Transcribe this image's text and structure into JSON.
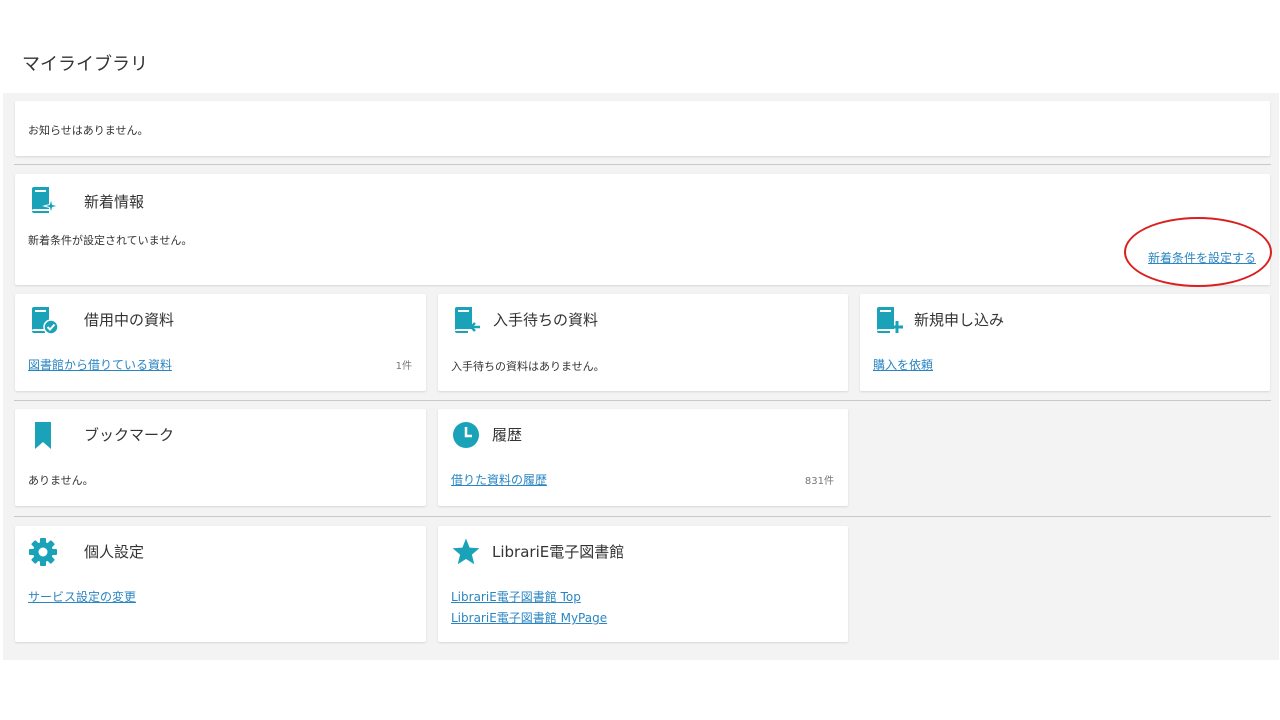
{
  "page_title": "マイライブラリ",
  "notice": {
    "text": "お知らせはありません。"
  },
  "new_info": {
    "title": "新着情報",
    "status": "新着条件が設定されていません。",
    "link": "新着条件を設定する"
  },
  "borrowing": {
    "title": "借用中の資料",
    "link": "図書館から借りている資料",
    "count": "1件"
  },
  "waiting": {
    "title": "入手待ちの資料",
    "status": "入手待ちの資料はありません。"
  },
  "new_request": {
    "title": "新規申し込み",
    "link": "購入を依頼"
  },
  "bookmark": {
    "title": "ブックマーク",
    "status": "ありません。"
  },
  "history": {
    "title": "履歴",
    "link": "借りた資料の履歴",
    "count": "831件"
  },
  "settings": {
    "title": "個人設定",
    "link": "サービス設定の変更"
  },
  "librarie": {
    "title": "LibrariE電子図書館",
    "link_top": "LibrariE電子図書館 Top",
    "link_mypage": "LibrariE電子図書館 MyPage"
  },
  "colors": {
    "icon": "#1aa3b8",
    "link": "#2a86c2",
    "annotation": "#d9201f"
  }
}
